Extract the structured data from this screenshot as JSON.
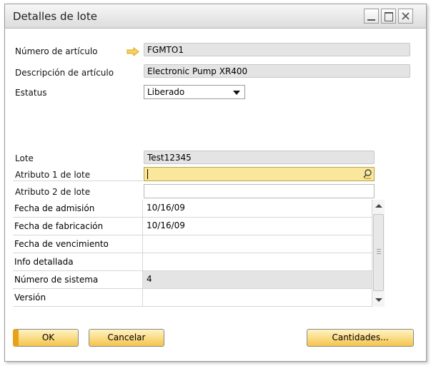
{
  "window": {
    "title": "Detalles de lote"
  },
  "fields": {
    "item_number": {
      "label": "Número de artículo",
      "value": "FGMTO1"
    },
    "item_description": {
      "label": "Descripción de artículo",
      "value": "Electronic Pump XR400"
    },
    "status": {
      "label": "Estatus",
      "value": "Liberado"
    },
    "batch": {
      "label": "Lote",
      "value": "Test12345"
    },
    "batch_attr1": {
      "label": "Atributo 1 de lote",
      "value": ""
    },
    "batch_attr2": {
      "label": "Atributo 2 de lote",
      "value": ""
    }
  },
  "grid": [
    {
      "label": "Fecha de admisión",
      "value": "10/16/09"
    },
    {
      "label": "Fecha de fabricación",
      "value": "10/16/09"
    },
    {
      "label": "Fecha de vencimiento",
      "value": ""
    },
    {
      "label": "Info detallada",
      "value": ""
    },
    {
      "label": "Número de sistema",
      "value": "4"
    },
    {
      "label": "Versión",
      "value": ""
    }
  ],
  "buttons": {
    "ok": "OK",
    "cancel": "Cancelar",
    "quantities": "Cantidades..."
  },
  "colors": {
    "accent": "#f5c44b",
    "highlight_field": "#fbe79c",
    "arrow": "#f2c12e"
  }
}
